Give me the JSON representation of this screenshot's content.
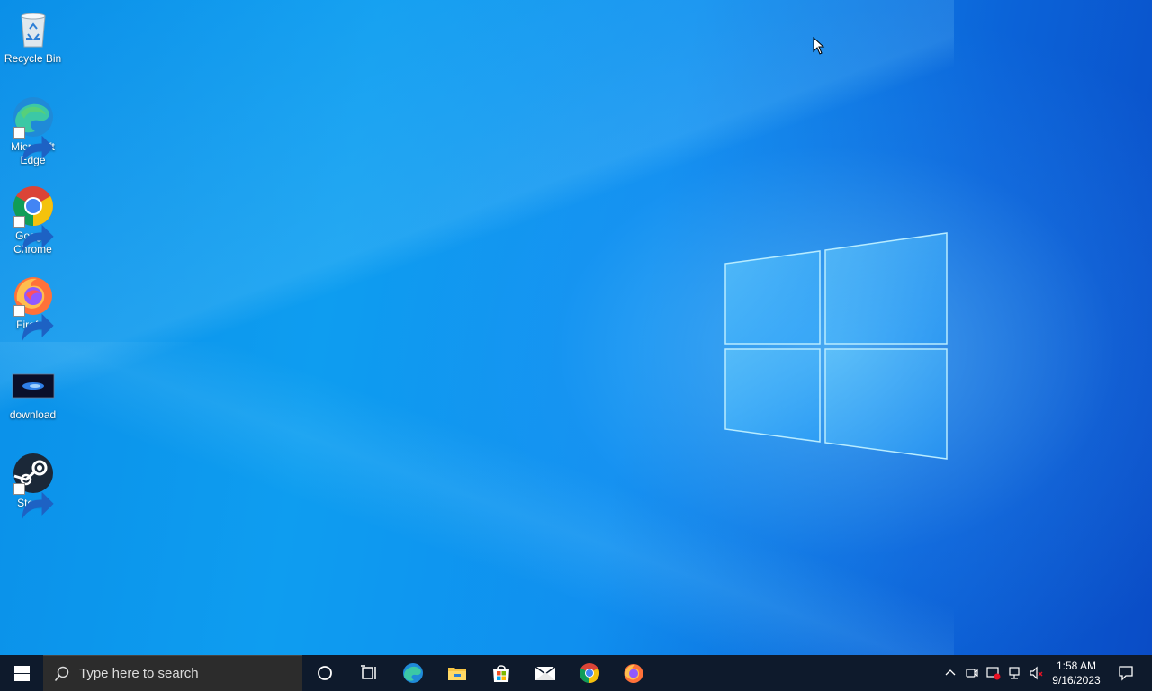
{
  "desktop": {
    "icons": [
      {
        "label": "Recycle Bin",
        "icon": "recycle-bin-icon"
      },
      {
        "label": "Microsoft Edge",
        "icon": "edge-icon"
      },
      {
        "label": "Google Chrome",
        "icon": "chrome-icon"
      },
      {
        "label": "Firefox",
        "icon": "firefox-icon"
      },
      {
        "label": "download",
        "icon": "image-file-icon"
      },
      {
        "label": "Steam",
        "icon": "steam-icon"
      }
    ]
  },
  "taskbar": {
    "search_placeholder": "Type here to search",
    "pinned": [
      "cortana-icon",
      "task-view-icon",
      "edge-icon",
      "file-explorer-icon",
      "microsoft-store-icon",
      "mail-icon",
      "chrome-icon",
      "firefox-icon"
    ],
    "tray": [
      "chevron-up-icon",
      "meet-now-icon",
      "security-alert-icon",
      "network-icon",
      "volume-muted-icon"
    ],
    "clock": {
      "time": "1:58 AM",
      "date": "9/16/2023"
    }
  },
  "colors": {
    "taskbar": "#0e1a2c",
    "desktop_accent": "#0f8fef"
  }
}
